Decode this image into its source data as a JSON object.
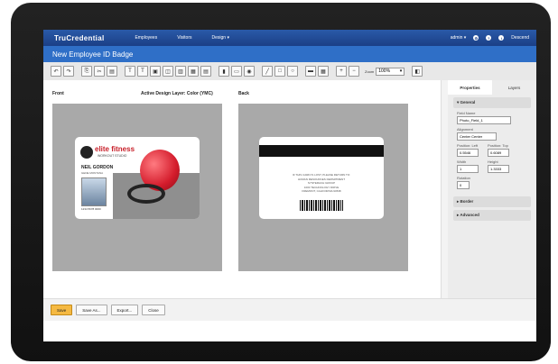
{
  "nav": {
    "logo": "TruCredential",
    "items": [
      "Employees",
      "Visitors",
      "Design ▾"
    ],
    "user": "admin ▾",
    "logout": "Descend"
  },
  "title": "New Employee ID Badge",
  "toolbar": {
    "zoom_label": "Zoom",
    "zoom_value": "100%"
  },
  "canvas": {
    "front_label": "Front",
    "layer_label": "Active Design Layer: Color (YMC)",
    "back_label": "Back",
    "front_card": {
      "brand": "elite fitness",
      "brand_sub": "WORKOUT STUDIO",
      "name": "NEIL GORDON",
      "role": "GENE MONTANA",
      "id": "1234 5678 0000"
    },
    "back_card": {
      "lines": [
        "IF THIS CARD IS LOST, PLEASE RETURN TO:",
        "HUMAN RESOURCES DEPARTMENT",
        "SYNTERACH GROUP",
        "1000 TECHNOLOGY DRIVE",
        "FREMONT, CALIFORNIA 94538"
      ]
    }
  },
  "properties": {
    "tabs": [
      "Properties",
      "Layers"
    ],
    "general": "General",
    "field_name_label": "Field Name",
    "field_name": "Photo_Field_1",
    "alignment_label": "Alignment",
    "alignment": "Center Center",
    "pos_left_label": "Position: Left",
    "pos_left": "0.5546",
    "pos_top_label": "Position: Top",
    "pos_top": "0.6089",
    "width_label": "Width",
    "width": "1",
    "height_label": "Height",
    "height": "1.3333",
    "rotation_label": "Rotation",
    "rotation": "0",
    "border": "Border",
    "advanced": "Advanced"
  },
  "bottom": {
    "save": "Save",
    "save_as": "Save As...",
    "export": "Export...",
    "close": "Close"
  }
}
